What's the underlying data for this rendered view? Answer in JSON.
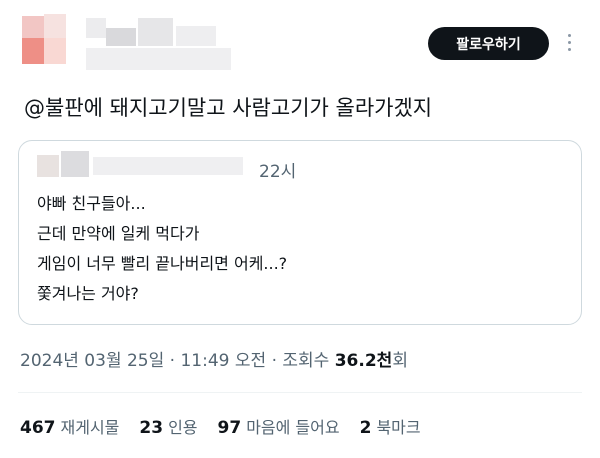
{
  "header": {
    "follow_label": "팔로우하기"
  },
  "tweet": {
    "text": "@불판에 돼지고기말고 사람고기가 올라가겠지"
  },
  "quote": {
    "time": "22시",
    "lines": [
      "야빠 친구들아...",
      "근데 만약에 일케 먹다가",
      "게임이 너무 빨리 끝나버리면 어케...?",
      "쫓겨나는 거야?"
    ]
  },
  "meta": {
    "date": "2024년 03월 25일",
    "sep1": " · ",
    "time": "11:49 오전",
    "sep2": " · ",
    "views_label": "조회수 ",
    "views_value": "36.2천",
    "views_suffix": "회"
  },
  "stats": [
    {
      "count": "467",
      "label": "재게시물"
    },
    {
      "count": "23",
      "label": "인용"
    },
    {
      "count": "97",
      "label": "마음에 들어요"
    },
    {
      "count": "2",
      "label": "북마크"
    }
  ],
  "colors": {
    "follow_bg": "#0f1419",
    "muted": "#536471",
    "border": "#cfd9de"
  }
}
